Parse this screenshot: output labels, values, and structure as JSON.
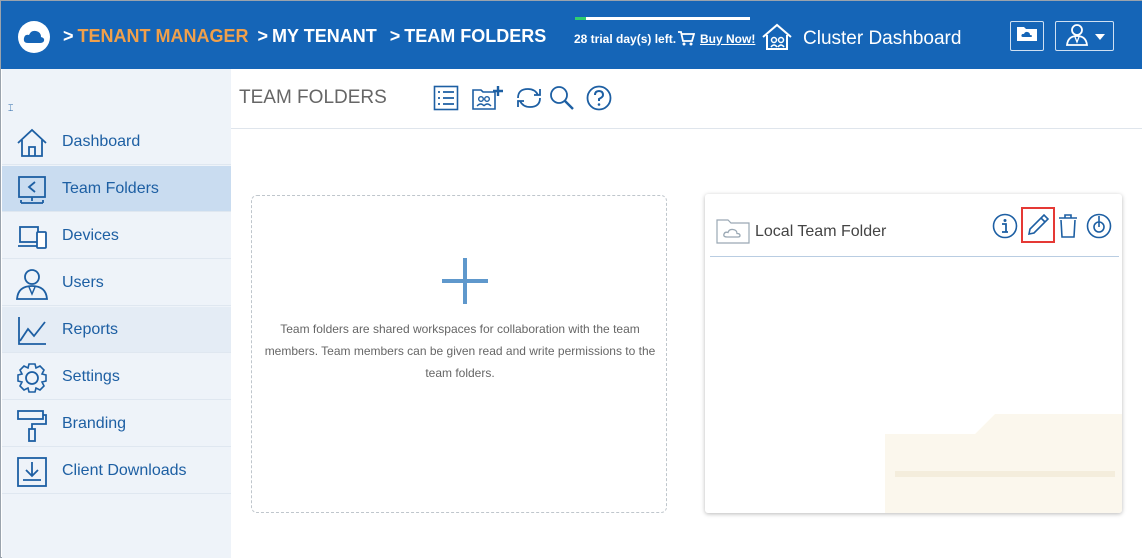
{
  "header": {
    "breadcrumb": [
      {
        "sep": ">",
        "label": "TENANT MANAGER"
      },
      {
        "sep": ">",
        "label": "MY TENANT"
      },
      {
        "sep": ">",
        "label": "TEAM FOLDERS"
      }
    ],
    "trial_progress": 0.06,
    "trial_text": "28 trial day(s) left.",
    "buy_now": "Buy Now!",
    "cluster_dashboard": "Cluster Dashboard",
    "icons": [
      "cloud-logo-icon",
      "cart-icon",
      "house-network-icon",
      "cloud-folder-icon",
      "user-icon",
      "caret-down-icon"
    ],
    "colors": {
      "bar": "#1565b7",
      "tenant_crumb": "#f0a04b",
      "progress": "#2fcf6f"
    }
  },
  "sidebar": {
    "collapse_glyph": "⌶",
    "items": [
      {
        "label": "Dashboard",
        "icon": "home-icon",
        "active": false
      },
      {
        "label": "Team Folders",
        "icon": "shared-folder-icon",
        "active": true
      },
      {
        "label": "Devices",
        "icon": "devices-icon",
        "active": false
      },
      {
        "label": "Users",
        "icon": "users-icon",
        "active": false
      },
      {
        "label": "Reports",
        "icon": "chart-icon",
        "active": false
      },
      {
        "label": "Settings",
        "icon": "gear-icon",
        "active": false
      },
      {
        "label": "Branding",
        "icon": "paint-roller-icon",
        "active": false
      },
      {
        "label": "Client Downloads",
        "icon": "download-icon",
        "active": false
      }
    ]
  },
  "main": {
    "title": "TEAM FOLDERS",
    "toolbar": [
      "list-view-icon",
      "add-team-folder-icon",
      "refresh-icon",
      "search-icon",
      "help-icon"
    ],
    "add_card": {
      "plus": "+",
      "description": "Team folders are shared workspaces for collaboration with the team members. Team members can be given read and write permissions to the team folders."
    },
    "folders": [
      {
        "name": "Local Team Folder",
        "actions": [
          "info-icon",
          "edit-icon",
          "delete-icon",
          "sync-icon"
        ],
        "highlighted_action": "edit-icon"
      }
    ]
  }
}
